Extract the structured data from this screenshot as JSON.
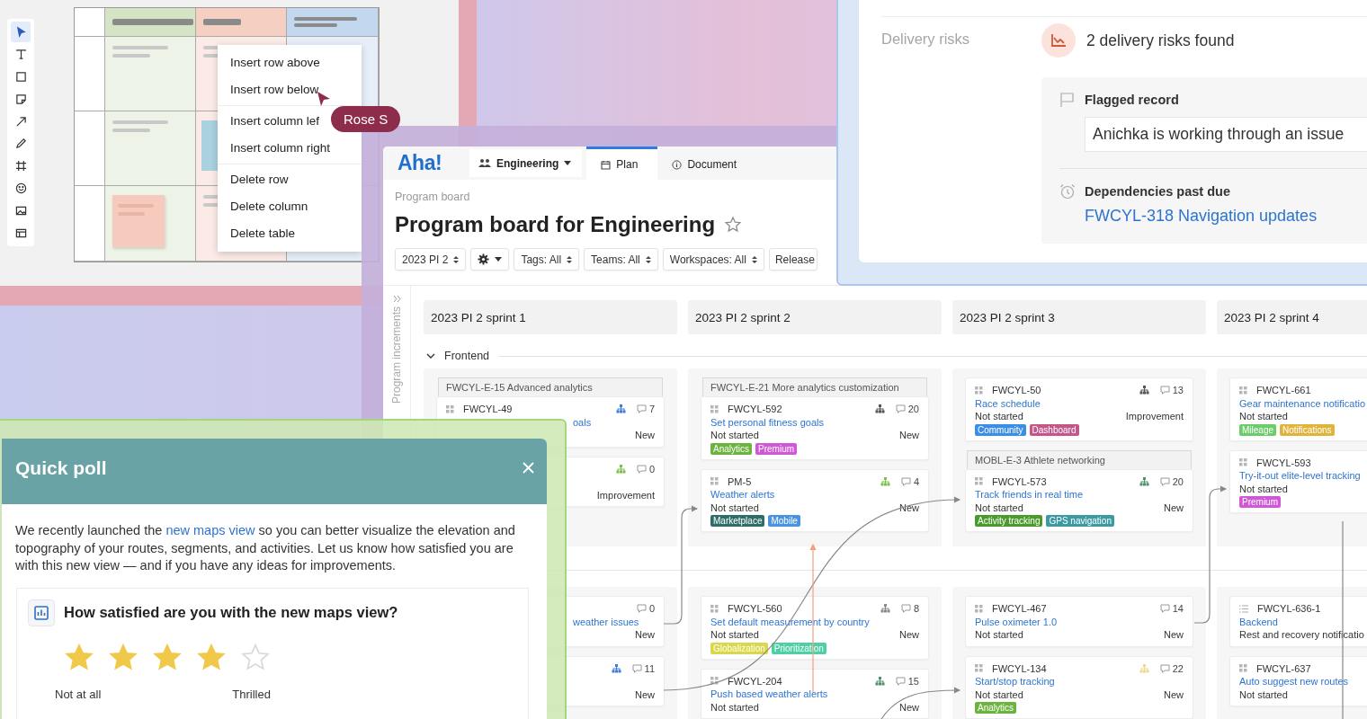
{
  "whiteboard": {
    "tools": [
      {
        "kind": "select",
        "selected": true
      },
      {
        "kind": "text",
        "selected": false
      },
      {
        "kind": "rectangle",
        "selected": false
      },
      {
        "kind": "note",
        "selected": false
      },
      {
        "kind": "arrow",
        "selected": false
      },
      {
        "kind": "pen",
        "selected": false
      },
      {
        "kind": "frame",
        "selected": false
      },
      {
        "kind": "emoji",
        "selected": false
      },
      {
        "kind": "image",
        "selected": false
      },
      {
        "kind": "table",
        "selected": false
      }
    ],
    "context_menu": {
      "groups": [
        [
          "Insert row above",
          "Insert row below"
        ],
        [
          "Insert column lef",
          "Insert column right"
        ],
        [
          "Delete row",
          "Delete column",
          "Delete table"
        ]
      ]
    },
    "cursor": {
      "label": "Rose S"
    }
  },
  "board": {
    "logo": "Aha!",
    "workspace": "Engineering",
    "tabs": [
      {
        "label": "Plan",
        "kind": "plan",
        "selected": true
      },
      {
        "label": "Document",
        "kind": "document",
        "selected": false
      }
    ],
    "breadcrumb": "Program board",
    "title": "Program board for Engineering",
    "favorite": false,
    "filters": [
      {
        "kind": "select",
        "label": "2023 PI 2"
      },
      {
        "kind": "settings"
      },
      {
        "kind": "select",
        "label": "Tags: All"
      },
      {
        "kind": "select",
        "label": "Teams: All"
      },
      {
        "kind": "select",
        "label": "Workspaces: All"
      },
      {
        "kind": "plain",
        "label": "Release"
      }
    ],
    "rail_label": "Program increments",
    "sprints": [
      "2023 PI 2 sprint 1",
      "2023 PI 2 sprint 2",
      "2023 PI 2 sprint 3",
      "2023 PI 2 sprint 4"
    ],
    "group": {
      "label": "Frontend",
      "expanded": true
    },
    "rows": [
      [
        {
          "items": [
            {
              "kind": "epic",
              "label": "FWCYL-E-15 Advanced analytics"
            },
            {
              "kind": "feature",
              "id": "FWCYL-49",
              "title": "oals",
              "partial": true,
              "type": "New",
              "comments": "7",
              "dependency": {
                "color": "#3b7dd8"
              }
            },
            {
              "kind": "feature",
              "partial": true,
              "type": "Improvement",
              "comments": "0",
              "dependency": {
                "color": "#7cbf4a"
              }
            }
          ]
        },
        {
          "items": [
            {
              "kind": "epic",
              "label": "FWCYL-E-21 More analytics customization"
            },
            {
              "kind": "feature",
              "id": "FWCYL-592",
              "title": "Set personal fitness goals",
              "status": "Not started",
              "type": "New",
              "comments": "20",
              "dependency": {
                "color": "#555555"
              },
              "tags": [
                {
                  "label": "Analytics",
                  "color": "#6cb33f"
                },
                {
                  "label": "Premium",
                  "color": "#d057d6"
                }
              ]
            },
            {
              "kind": "feature",
              "id": "PM-5",
              "title": "Weather alerts",
              "status": "Not started",
              "type": "New",
              "comments": "4",
              "dependency": {
                "color": "#7cbf4a"
              },
              "tags": [
                {
                  "label": "Marketplace",
                  "color": "#2f6e68"
                },
                {
                  "label": "Mobile",
                  "color": "#4a93e0"
                }
              ]
            }
          ]
        },
        {
          "items": [
            {
              "kind": "feature",
              "id": "FWCYL-50",
              "title": "Race schedule",
              "status": "Not started",
              "type": "Improvement",
              "comments": "13",
              "dependency": {
                "color": "#555555"
              },
              "tags": [
                {
                  "label": "Community",
                  "color": "#3a8ee6"
                },
                {
                  "label": "Dashboard",
                  "color": "#c4578a"
                }
              ]
            },
            {
              "kind": "epic",
              "label": "MOBL-E-3 Athlete networking"
            },
            {
              "kind": "feature",
              "id": "FWCYL-573",
              "title": "Track friends in real time",
              "status": "Not started",
              "type": "New",
              "comments": "20",
              "dependency": {
                "color": "#4f8f6a"
              },
              "tags": [
                {
                  "label": "Activity tracking",
                  "color": "#4a9a2c"
                },
                {
                  "label": "GPS navigation",
                  "color": "#3d9aa2"
                }
              ]
            }
          ]
        },
        {
          "items": [
            {
              "kind": "feature",
              "id": "FWCYL-661",
              "title": "Gear maintenance notificatio",
              "status": "Not started",
              "tags": [
                {
                  "label": "Mileage",
                  "color": "#6acd6a"
                },
                {
                  "label": "Notifications",
                  "color": "#e0b43a"
                }
              ]
            },
            {
              "kind": "feature",
              "id": "FWCYL-593",
              "title": "Try-it-out elite-level tracking",
              "status": "Not started",
              "tags": [
                {
                  "label": "Premium",
                  "color": "#d057d6"
                }
              ]
            }
          ]
        }
      ],
      [
        {
          "items": [
            {
              "kind": "feature",
              "title": "weather issues",
              "partial": true,
              "type": "New",
              "comments": "0"
            },
            {
              "kind": "feature",
              "partial": true,
              "type": "New",
              "comments": "11",
              "dependency": {
                "color": "#3b7dd8"
              }
            }
          ]
        },
        {
          "items": [
            {
              "kind": "feature",
              "id": "FWCYL-560",
              "title": "Set default measurement by country",
              "status": "Not started",
              "type": "New",
              "comments": "8",
              "dependency": {
                "color": "#8a8a8a"
              },
              "tags": [
                {
                  "label": "Globalization",
                  "color": "#d8d84a"
                },
                {
                  "label": "Prioritization",
                  "color": "#4fcfa6"
                }
              ]
            },
            {
              "kind": "feature",
              "id": "FWCYL-204",
              "title": "Push based weather alerts",
              "status": "Not started",
              "type": "New",
              "comments": "15",
              "dependency": {
                "color": "#4f8f6a"
              }
            }
          ]
        },
        {
          "items": [
            {
              "kind": "feature",
              "id": "FWCYL-467",
              "title": "Pulse oximeter 1.0",
              "status": "Not started",
              "type": "New",
              "comments": "14"
            },
            {
              "kind": "feature",
              "id": "FWCYL-134",
              "title": "Start/stop tracking",
              "status": "Not started",
              "type": "New",
              "comments": "22",
              "dependency": {
                "color": "#f0d890"
              },
              "tags": [
                {
                  "label": "Analytics",
                  "color": "#6cb33f"
                }
              ]
            }
          ]
        },
        {
          "items": [
            {
              "kind": "requirement",
              "id": "FWCYL-636-1",
              "title": "Backend",
              "status": "Rest and recovery notificatio"
            },
            {
              "kind": "feature",
              "id": "FWCYL-637",
              "title": "Auto suggest new routes",
              "status": "Not started"
            }
          ]
        }
      ]
    ]
  },
  "risks": {
    "label": "Delivery risks",
    "summary": "2 delivery risks found",
    "items": [
      {
        "kind": "flag",
        "title": "Flagged record",
        "note": "Anichka is working through an issue"
      },
      {
        "kind": "due",
        "title": "Dependencies past due",
        "link": "FWCYL-318 Navigation updates"
      }
    ]
  },
  "poll": {
    "title": "Quick poll",
    "text_before": "We recently launched the",
    "link": "new maps view",
    "text_after": "so you can better visualize the elevation and topography of your routes, segments, and activities. Let us know how satisfied you are with this new view — and if you have any ideas for improvements.",
    "question": "How satisfied are you with the new maps view?",
    "stars": 4,
    "scale_low": "Not at all",
    "scale_high": "Thrilled"
  }
}
